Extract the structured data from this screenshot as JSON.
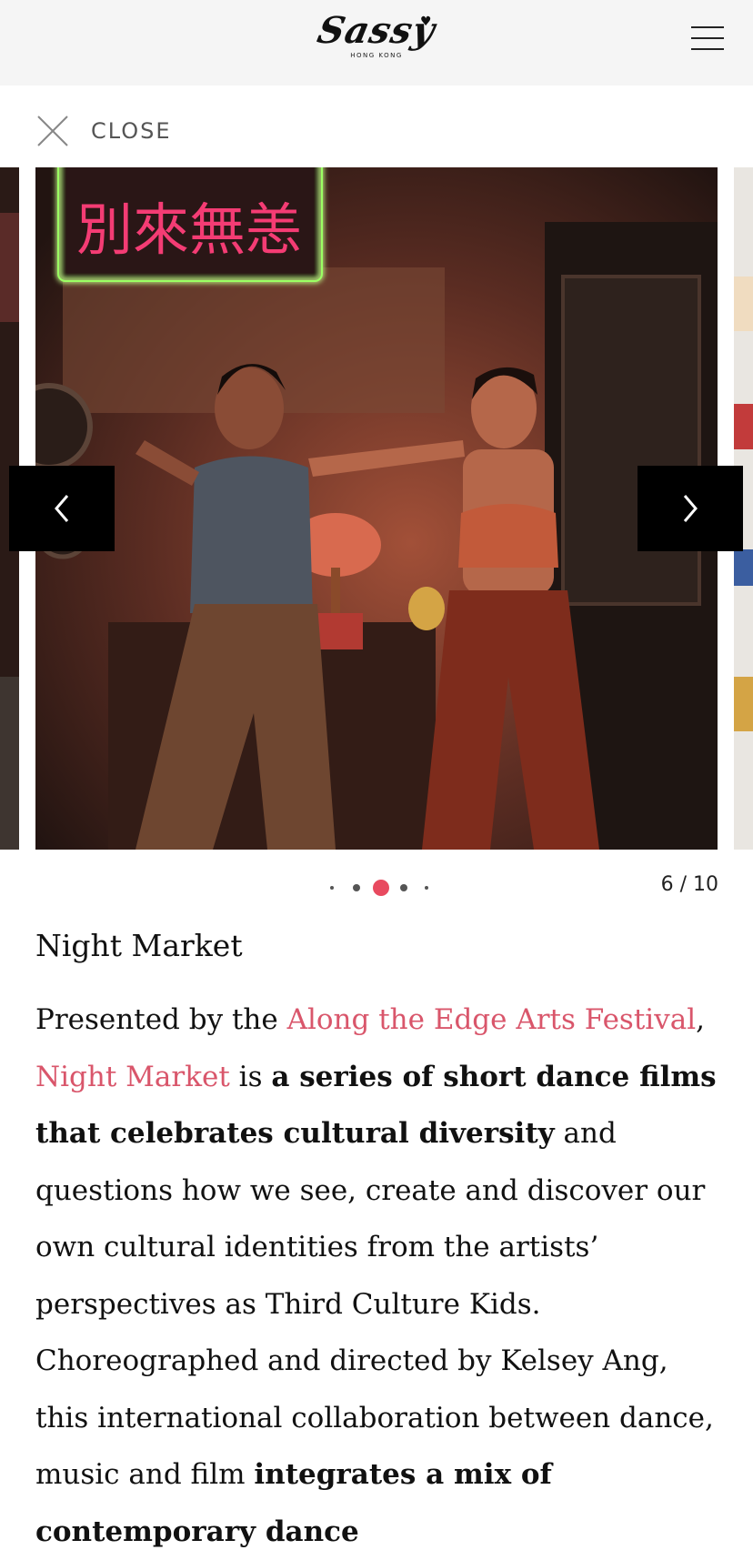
{
  "header": {
    "logo_text": "Sassy",
    "logo_subtext": "HONG KONG",
    "menu_icon": "hamburger-menu-icon"
  },
  "close": {
    "label": "CLOSE",
    "icon": "close-icon"
  },
  "gallery": {
    "current_index": 6,
    "total": 10,
    "counter_separator": "/",
    "image_alt": "Two dancers posing in a neon-lit retro room",
    "prev_icon": "chevron-left-icon",
    "next_icon": "chevron-right-icon",
    "accent_color": "#e84a5f"
  },
  "caption": {
    "title": "Night Market",
    "body": {
      "presented_prefix": "Presented by the ",
      "festival_link": "Along the Edge Arts Festival",
      "comma": ",",
      "night_market_link": "Night Market",
      "is_text": " is ",
      "bold_1": "a series of short dance films that celebrates cultural diversity",
      "mid_text": " and questions how we see, create and discover our own cultural identities from the artists’ perspectives as Third Culture Kids. Choreographed and directed by Kelsey Ang, this international collaboration between dance, music and film ",
      "bold_2": "integrates a mix of contemporary dance"
    }
  },
  "colors": {
    "link": "#d9566b",
    "header_bg": "#f5f5f5",
    "nav_bg": "#000000"
  }
}
